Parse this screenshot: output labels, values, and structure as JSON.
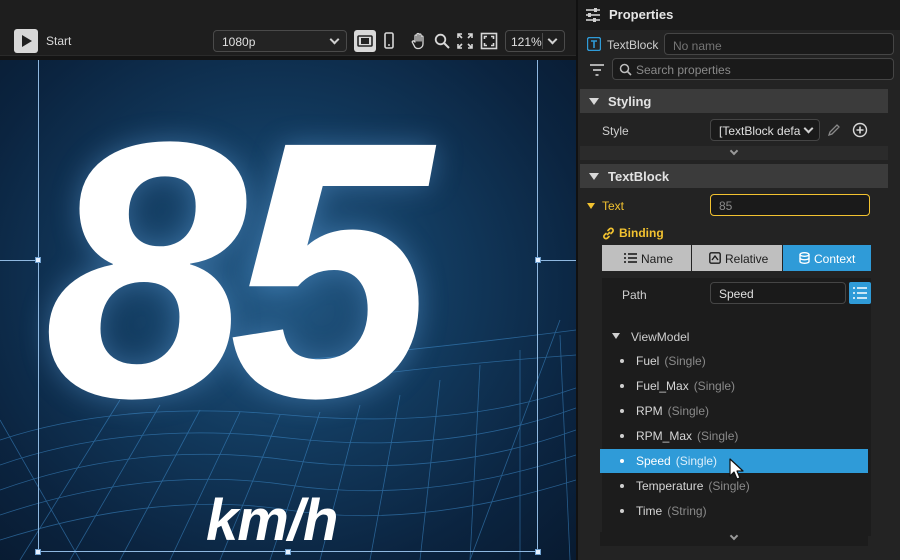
{
  "toolbar": {
    "start_label": "Start",
    "resolution": "1080p",
    "zoom": "121%"
  },
  "canvas": {
    "value_text": "85",
    "unit_text": "km/h"
  },
  "panel": {
    "title": "Properties",
    "element_type": "TextBlock",
    "name_placeholder": "No name",
    "search_placeholder": "Search properties",
    "styling": {
      "header": "Styling",
      "style_label": "Style",
      "style_value": "[TextBlock defa"
    },
    "textblock": {
      "header": "TextBlock",
      "text_label": "Text",
      "text_value": "85",
      "binding_label": "Binding",
      "modes": [
        "Name",
        "Relative",
        "Context"
      ],
      "active_mode": "Context",
      "path_label": "Path",
      "path_value": "Speed"
    },
    "tree": {
      "root": "ViewModel",
      "items": [
        {
          "name": "Fuel",
          "type": "(Single)"
        },
        {
          "name": "Fuel_Max",
          "type": "(Single)"
        },
        {
          "name": "RPM",
          "type": "(Single)"
        },
        {
          "name": "RPM_Max",
          "type": "(Single)"
        },
        {
          "name": "Speed",
          "type": "(Single)"
        },
        {
          "name": "Temperature",
          "type": "(Single)"
        },
        {
          "name": "Time",
          "type": "(String)"
        }
      ],
      "selected": "Speed"
    }
  },
  "colors": {
    "accent_blue": "#2f9bd8",
    "binding_yellow": "#f2c230",
    "panel_bg": "#232323"
  }
}
